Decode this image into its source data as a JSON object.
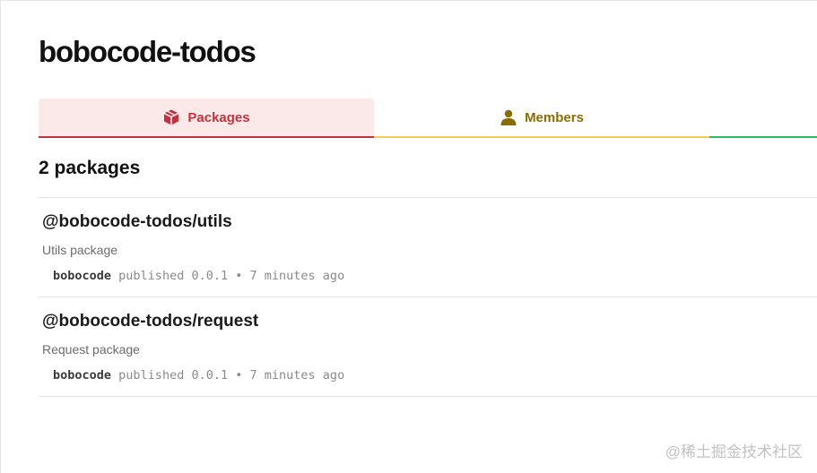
{
  "org": {
    "title": "bobocode-todos"
  },
  "tabs": [
    {
      "label": "Packages",
      "icon": "package-icon",
      "color": "#c1323e"
    },
    {
      "label": "Members",
      "icon": "user-icon",
      "color": "#8a6d00"
    }
  ],
  "packages_count_label": "2 packages",
  "packages": [
    {
      "name": "@bobocode-todos/utils",
      "description": "Utils package",
      "author": "bobocode",
      "published_word": "published",
      "version": "0.0.1",
      "separator": "•",
      "time_ago": "7 minutes ago"
    },
    {
      "name": "@bobocode-todos/request",
      "description": "Request package",
      "author": "bobocode",
      "published_word": "published",
      "version": "0.0.1",
      "separator": "•",
      "time_ago": "7 minutes ago"
    }
  ],
  "watermark": "@稀土掘金技术社区",
  "colors": {
    "packages_tab_bg": "#fbe9ea",
    "packages_tab_accent": "#c1323e",
    "members_tab_accent": "#f5cd4f",
    "third_tab_accent": "#2dbb6b"
  }
}
